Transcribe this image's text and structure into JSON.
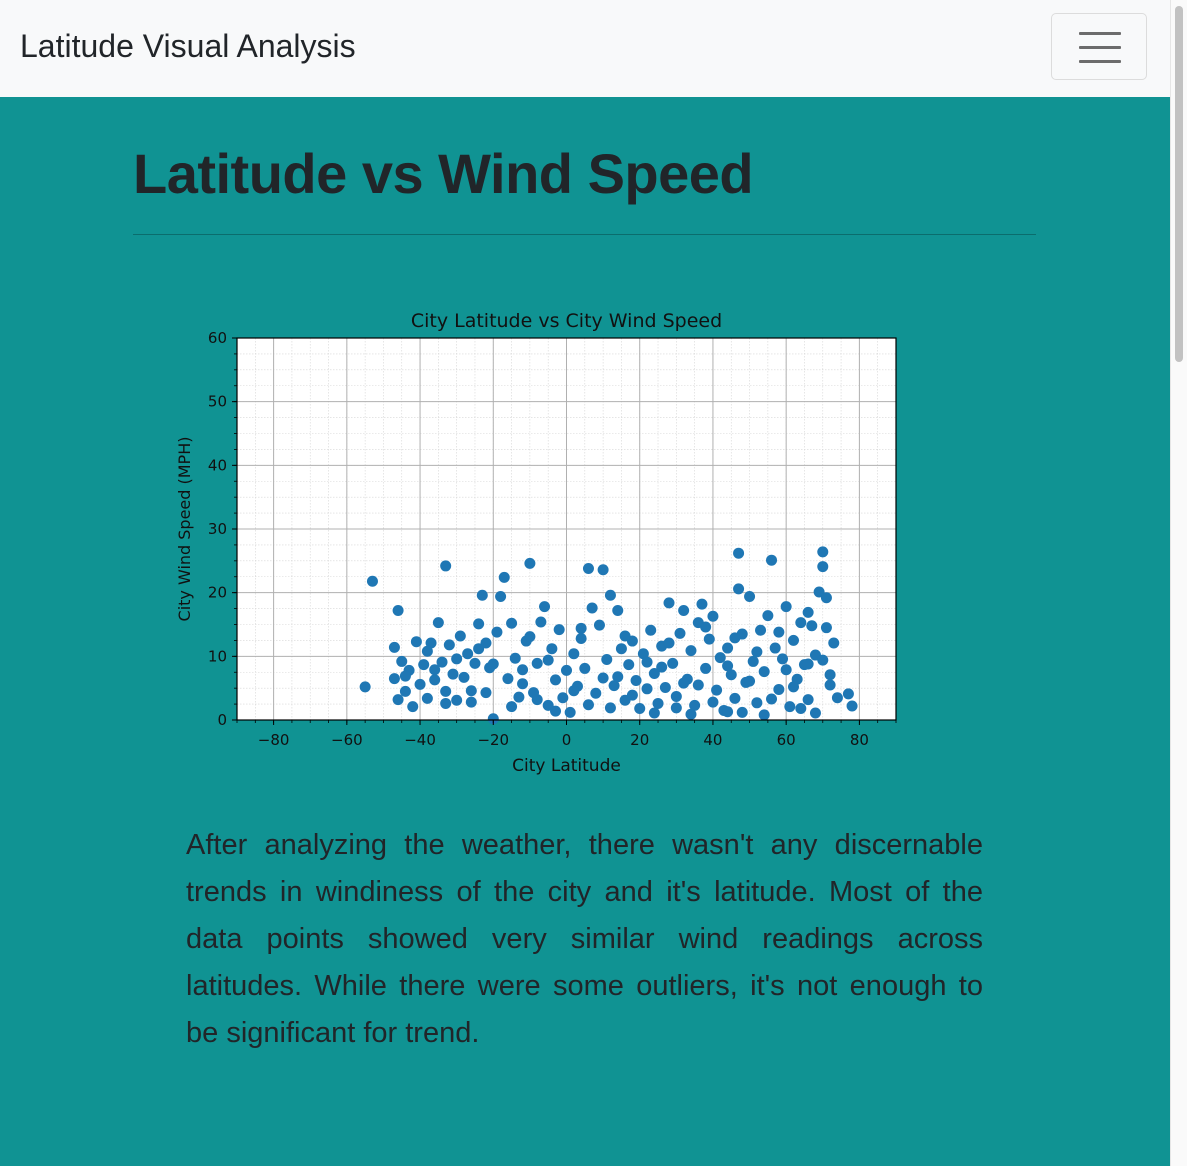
{
  "navbar": {
    "brand": "Latitude Visual Analysis",
    "toggler_icon": "hamburger-menu-icon"
  },
  "page": {
    "title": "Latitude vs Wind Speed",
    "description": "After analyzing the weather, there wasn't any discernable trends in windiness of the city and it's latitude. Most of the data points showed very similar wind readings across latitudes. While there were some outliers, it's not enough to be significant for trend."
  },
  "colors": {
    "background": "#109393",
    "navbar": "#f8f9fa",
    "marker": "#1f77b4",
    "text": "#212529"
  },
  "chart_data": {
    "type": "scatter",
    "title": "City Latitude vs City Wind Speed",
    "xlabel": "City Latitude",
    "ylabel": "City Wind Speed (MPH)",
    "xlim": [
      -90,
      90
    ],
    "ylim": [
      0,
      60
    ],
    "xticks": [
      -80,
      -60,
      -40,
      -20,
      0,
      20,
      40,
      60,
      80
    ],
    "yticks": [
      0,
      10,
      20,
      30,
      40,
      50,
      60
    ],
    "grid": true,
    "minor_grid": true,
    "series": [
      {
        "color": "#1f77b4",
        "points": [
          [
            -55,
            5.2
          ],
          [
            -53,
            21.8
          ],
          [
            -46,
            17.2
          ],
          [
            -47,
            11.4
          ],
          [
            -47,
            6.5
          ],
          [
            -46,
            3.2
          ],
          [
            -45,
            9.2
          ],
          [
            -44,
            4.5
          ],
          [
            -43,
            7.8
          ],
          [
            -42,
            2.1
          ],
          [
            -41,
            12.3
          ],
          [
            -40,
            5.6
          ],
          [
            -39,
            8.7
          ],
          [
            -38,
            3.4
          ],
          [
            -37,
            12.1
          ],
          [
            -36,
            6.3
          ],
          [
            -35,
            15.3
          ],
          [
            -34,
            9.1
          ],
          [
            -33,
            24.2
          ],
          [
            -33,
            4.5
          ],
          [
            -32,
            11.8
          ],
          [
            -31,
            7.2
          ],
          [
            -30,
            3.1
          ],
          [
            -29,
            13.2
          ],
          [
            -28,
            6.7
          ],
          [
            -27,
            10.4
          ],
          [
            -26,
            2.8
          ],
          [
            -25,
            8.9
          ],
          [
            -24,
            15.1
          ],
          [
            -23,
            19.6
          ],
          [
            -22,
            12.1
          ],
          [
            -22,
            4.3
          ],
          [
            -21,
            8.2
          ],
          [
            -20,
            0.2
          ],
          [
            -19,
            13.8
          ],
          [
            -18,
            19.4
          ],
          [
            -17,
            22.4
          ],
          [
            -16,
            6.5
          ],
          [
            -15,
            15.2
          ],
          [
            -14,
            9.7
          ],
          [
            -13,
            3.6
          ],
          [
            -12,
            7.9
          ],
          [
            -11,
            12.4
          ],
          [
            -10,
            24.6
          ],
          [
            -9,
            4.3
          ],
          [
            -8,
            8.9
          ],
          [
            -7,
            15.4
          ],
          [
            -6,
            17.8
          ],
          [
            -5,
            2.3
          ],
          [
            -4,
            11.2
          ],
          [
            -3,
            6.3
          ],
          [
            -2,
            14.2
          ],
          [
            -1,
            3.5
          ],
          [
            0,
            7.8
          ],
          [
            1,
            1.2
          ],
          [
            2,
            10.4
          ],
          [
            3,
            5.3
          ],
          [
            4,
            12.8
          ],
          [
            5,
            8.1
          ],
          [
            6,
            23.8
          ],
          [
            7,
            17.6
          ],
          [
            8,
            4.2
          ],
          [
            9,
            14.9
          ],
          [
            10,
            23.6
          ],
          [
            11,
            9.5
          ],
          [
            12,
            19.6
          ],
          [
            13,
            5.4
          ],
          [
            14,
            17.2
          ],
          [
            15,
            11.2
          ],
          [
            16,
            3.1
          ],
          [
            17,
            8.7
          ],
          [
            18,
            12.4
          ],
          [
            19,
            6.2
          ],
          [
            20,
            1.8
          ],
          [
            21,
            10.4
          ],
          [
            22,
            4.9
          ],
          [
            23,
            14.1
          ],
          [
            24,
            7.3
          ],
          [
            25,
            2.6
          ],
          [
            26,
            11.6
          ],
          [
            27,
            5.1
          ],
          [
            28,
            18.4
          ],
          [
            29,
            8.9
          ],
          [
            30,
            3.7
          ],
          [
            31,
            13.6
          ],
          [
            32,
            17.2
          ],
          [
            33,
            6.4
          ],
          [
            34,
            10.9
          ],
          [
            35,
            2.3
          ],
          [
            36,
            15.3
          ],
          [
            37,
            18.2
          ],
          [
            38,
            8.1
          ],
          [
            39,
            12.7
          ],
          [
            40,
            16.3
          ],
          [
            41,
            4.7
          ],
          [
            42,
            9.8
          ],
          [
            43,
            1.5
          ],
          [
            44,
            11.3
          ],
          [
            45,
            7.1
          ],
          [
            46,
            3.4
          ],
          [
            47,
            26.2
          ],
          [
            47,
            20.6
          ],
          [
            48,
            13.5
          ],
          [
            49,
            5.9
          ],
          [
            50,
            19.4
          ],
          [
            51,
            9.2
          ],
          [
            52,
            2.7
          ],
          [
            53,
            14.1
          ],
          [
            54,
            7.6
          ],
          [
            55,
            16.4
          ],
          [
            56,
            25.1
          ],
          [
            57,
            11.3
          ],
          [
            58,
            4.8
          ],
          [
            59,
            9.6
          ],
          [
            60,
            17.8
          ],
          [
            61,
            2.1
          ],
          [
            62,
            12.5
          ],
          [
            63,
            6.4
          ],
          [
            64,
            15.3
          ],
          [
            65,
            8.7
          ],
          [
            66,
            3.2
          ],
          [
            67,
            14.8
          ],
          [
            68,
            10.2
          ],
          [
            69,
            20.1
          ],
          [
            70,
            26.4
          ],
          [
            70,
            24.1
          ],
          [
            71,
            19.2
          ],
          [
            71,
            14.5
          ],
          [
            72,
            7.1
          ],
          [
            73,
            12.1
          ],
          [
            74,
            3.5
          ],
          [
            77,
            4.1
          ],
          [
            78,
            2.2
          ],
          [
            -30,
            9.6
          ],
          [
            -12,
            5.7
          ],
          [
            2,
            4.6
          ],
          [
            14,
            6.8
          ],
          [
            26,
            8.3
          ],
          [
            36,
            5.5
          ],
          [
            50,
            6.1
          ],
          [
            60,
            7.9
          ],
          [
            66,
            8.8
          ],
          [
            -38,
            10.8
          ],
          [
            -20,
            8.8
          ],
          [
            -5,
            9.4
          ],
          [
            10,
            6.6
          ],
          [
            22,
            9.1
          ],
          [
            32,
            5.8
          ],
          [
            44,
            8.5
          ],
          [
            52,
            10.7
          ],
          [
            62,
            5.2
          ],
          [
            70,
            9.4
          ],
          [
            -44,
            6.9
          ],
          [
            -26,
            4.6
          ],
          [
            -8,
            3.2
          ],
          [
            6,
            2.4
          ],
          [
            18,
            3.9
          ],
          [
            30,
            1.9
          ],
          [
            40,
            2.8
          ],
          [
            48,
            1.2
          ],
          [
            56,
            3.3
          ],
          [
            64,
            1.8
          ],
          [
            72,
            5.5
          ],
          [
            -15,
            2.1
          ],
          [
            -3,
            1.4
          ],
          [
            12,
            1.9
          ],
          [
            24,
            1.1
          ],
          [
            34,
            0.9
          ],
          [
            44,
            1.3
          ],
          [
            54,
            0.8
          ],
          [
            68,
            1.1
          ],
          [
            -33,
            2.6
          ],
          [
            -36,
            7.9
          ],
          [
            -24,
            11.2
          ],
          [
            -10,
            13.1
          ],
          [
            4,
            14.4
          ],
          [
            16,
            13.2
          ],
          [
            28,
            12.1
          ],
          [
            38,
            14.6
          ],
          [
            46,
            12.9
          ],
          [
            58,
            13.8
          ],
          [
            66,
            16.9
          ]
        ]
      }
    ]
  }
}
